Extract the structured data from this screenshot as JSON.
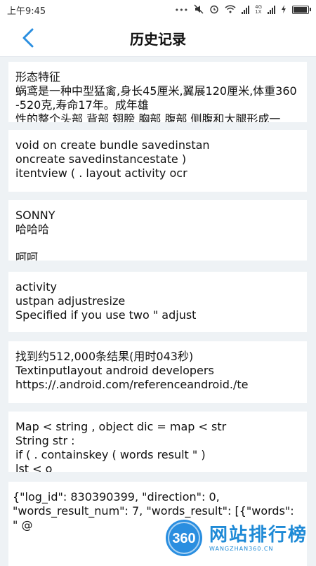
{
  "status": {
    "time": "上午9:45",
    "network": "4G",
    "network_sub": "1X"
  },
  "header": {
    "title": "历史记录"
  },
  "records": [
    {
      "lines": [
        "形态特征",
        "蜗鸢是一种中型猛禽,身长45厘米,翼展120厘米,体重360-520克,寿命17年。成年雄",
        "性的整个头部 背部 翅膀 胸部 腹部 侧腹和大腿形成一"
      ]
    },
    {
      "lines": [
        "void on create bundle savedinstan",
        "oncreate savedinstancestate )",
        "itentview ( . layout activity ocr"
      ]
    },
    {
      "lines": [
        "SONNY",
        "哈哈哈",
        "",
        "呵呵"
      ]
    },
    {
      "lines": [
        "activity",
        "ustpan adjustresize",
        "Specified if you use two \" adjust"
      ]
    },
    {
      "lines": [
        "找到约512,000条结果(用时043秒)",
        "Textinputlayout android developers",
        "https://.android.com/referenceandroid./te"
      ]
    },
    {
      "lines": [
        "Map < string , object dic = map < str",
        "String str :",
        "if ( . containskey ( words result \" )",
        "lst < o"
      ]
    },
    {
      "lines": [
        "{\"log_id\": 830390399, \"direction\": 0,",
        "\"words_result_num\": 7, \"words_result\": [{\"words\": \" @"
      ]
    }
  ],
  "watermark": {
    "badge": "360",
    "cn": "网站排行榜",
    "en": "WANGZHAN360.CN"
  }
}
